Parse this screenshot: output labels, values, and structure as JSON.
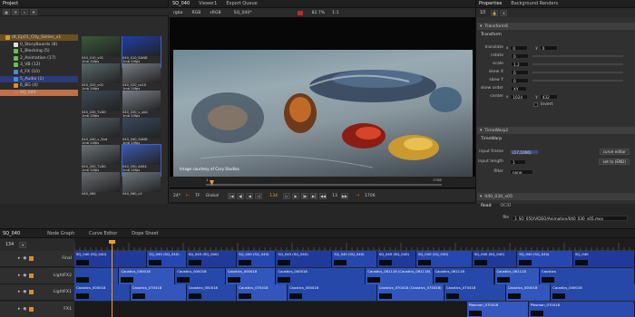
{
  "project_panel": {
    "title": "Project",
    "tree": [
      {
        "label": "dt_Ep01_City_Series_v1",
        "color": "#d79a3a"
      },
      {
        "label": "0_StoryBoards (8)",
        "color": "#e0e0e0"
      },
      {
        "label": "1_Blocking (5)",
        "color": "#6ac04a"
      },
      {
        "label": "2_Animation (17)",
        "color": "#6ac04a"
      },
      {
        "label": "3_VB (12)",
        "color": "#6ac04a"
      },
      {
        "label": "4_FX (10)",
        "color": "#4a8ad8"
      },
      {
        "label": "5_Audio (1)",
        "color": "#4a8ad8"
      },
      {
        "label": "6_BG (4)",
        "color": "#e08a2a"
      },
      {
        "label": "SQ_040",
        "color": "#d0704a"
      }
    ],
    "thumbs": [
      {
        "line1": "040_010_v01",
        "line2": "1mb  24fps",
        "line3": "00:00:00:00 24f"
      },
      {
        "line1": "040_010_SAND",
        "line2": "1mb  24fps",
        "line3": "00:00:00:00 24f"
      },
      {
        "line1": "040_020_v02",
        "line2": "1mb  24fps",
        "line3": "00:00:00:00 24f"
      },
      {
        "line1": "040_020_ca10",
        "line2": "1mb  24fps",
        "line3": "00:00:00:00 24f"
      },
      {
        "line1": "040_030_TvD0",
        "line2": "1mb  24fps",
        "line3": "00:00:00:00 24f"
      },
      {
        "line1": "040_030_v_ab1",
        "line2": "1mb  24fps",
        "line3": "00:00:00:00 24f"
      },
      {
        "line1": "040_040_v_Shd",
        "line2": "1mb  24fps",
        "line3": "00:00:00:00 24f"
      },
      {
        "line1": "040_040_SAND",
        "line2": "1mb  24fps",
        "line3": "00:00:00:00 24f"
      },
      {
        "line1": "040_050_TvD0",
        "line2": "1mb  24fps",
        "line3": "00:00:00:00 24f"
      },
      {
        "line1": "040_050_A004",
        "line2": "1mb  24fps",
        "line3": "00:00:00:00 24f"
      },
      {
        "line1": "040_060",
        "line2": "",
        "line3": ""
      },
      {
        "line1": "040_060_v2",
        "line2": "",
        "line3": ""
      }
    ]
  },
  "viewer_panel": {
    "tabs": [
      "SQ_040",
      "Viewer1",
      "Export Queue"
    ],
    "toolbar": {
      "channels": "rgba",
      "colorspace": "RGB",
      "lut": "sRGB",
      "sequence": "SQ_040*",
      "zoom": "82.7%",
      "ratio": "1:1"
    },
    "credit": "Image courtesy of Cary Studios",
    "scrub_start": "1",
    "scrub_end": "1706",
    "frame_left": "24*",
    "tf": "TF",
    "global_label": "Global",
    "current_frame": "134",
    "step": "13",
    "end_frame": "1706"
  },
  "properties_panel": {
    "tabs": [
      "Properties",
      "Background Renders"
    ],
    "toolbar_number": "10",
    "nodes": [
      {
        "name": "Transform6",
        "section": "Transform"
      },
      {
        "name": "TimeWarp2",
        "section": "TimeWarp"
      },
      {
        "name": "040_030_v05",
        "section": "Read"
      }
    ],
    "transform": {
      "translate_label": "translate",
      "translate_x": "0",
      "translate_y": "0",
      "rotate_label": "rotate",
      "rotate": "0",
      "scale_label": "scale",
      "scale": "1.2",
      "skew_x_label": "skew X",
      "skew_x": "0",
      "skew_y_label": "skew Y",
      "skew_y": "0",
      "skew_order_label": "skew order",
      "skew_order": "XY",
      "center_label": "center",
      "center_x": "1024",
      "center_y": "432",
      "invert": "invert"
    },
    "timewarp": {
      "input_frame_label": "input frame",
      "input_frame": "(17,1006)",
      "curve_editor": "curve editor",
      "input_length_label": "input length",
      "input_length": "1",
      "set_to_end": "set to (END)",
      "filter_label": "filter",
      "filter": "none"
    },
    "read": {
      "tab": "OCIO",
      "file_label": "file",
      "file": "3_SQ_050/VIDEO/Animation/040_030_v05.mov"
    }
  },
  "timeline_panel": {
    "tabs": [
      "SQ_040",
      "Node Graph",
      "Curve Editor",
      "Dope Sheet"
    ],
    "frame": "134",
    "tracks": [
      {
        "name": "Final",
        "clips": [
          {
            "label": "SQ_040 (SQ_040)",
            "w": 13
          },
          {
            "label": "SQ_040 (SQ_040)",
            "w": 7
          },
          {
            "label": "SQ_040 (SQ_040)",
            "w": 9
          },
          {
            "label": "SQ_040 (SQ_040)",
            "w": 7
          },
          {
            "label": "SQ_040 (SQ_040)",
            "w": 10
          },
          {
            "label": "SQ_040 (SQ_040)",
            "w": 8
          },
          {
            "label": "SQ_040 (SQ_040)",
            "w": 7
          },
          {
            "label": "SQ_040 (SQ_040)",
            "w": 10
          },
          {
            "label": "SQ_040 (SQ_040)",
            "w": 8
          },
          {
            "label": "SQ_040 (SQ_040)",
            "w": 10
          },
          {
            "label": "SQ_040",
            "w": 11
          }
        ]
      },
      {
        "name": "LightFX2",
        "clips": [
          {
            "label": "",
            "w": 8
          },
          {
            "label": "Caustics_000018",
            "w": 10
          },
          {
            "label": "Caustics_000018",
            "w": 9
          },
          {
            "label": "Caustics_000018",
            "w": 9
          },
          {
            "label": "Caustics_000018",
            "w": 16
          },
          {
            "label": "Caustics_061118 (Caustics_061118)",
            "w": 12
          },
          {
            "label": "Caustics_061118",
            "w": 11
          },
          {
            "label": "Caustics_061118",
            "w": 8
          },
          {
            "label": "Caustics",
            "w": 17
          }
        ]
      },
      {
        "name": "LightFX1",
        "clips": [
          {
            "label": "Caustics_000018",
            "w": 10
          },
          {
            "label": "Caustics_070418",
            "w": 10
          },
          {
            "label": "Caustics_000018",
            "w": 9
          },
          {
            "label": "Caustics_070418",
            "w": 9
          },
          {
            "label": "Caustics_000018",
            "w": 16
          },
          {
            "label": "Caustics_070418 (Caustics_070418)",
            "w": 12
          },
          {
            "label": "Caustics_070418",
            "w": 11
          },
          {
            "label": "Caustics_000018",
            "w": 8
          },
          {
            "label": "Caustics_000018",
            "w": 17
          }
        ]
      },
      {
        "name": "FX1",
        "clips": [
          {
            "label": "",
            "w": 70
          },
          {
            "label": "Plasmon_070418",
            "w": 11
          },
          {
            "label": "Plasmon_070418",
            "w": 19
          }
        ]
      }
    ]
  },
  "colors": {
    "accent_orange": "#f39c2a",
    "clip_blue": "#2a4aa8",
    "clip_blue_light": "#3758c0",
    "selection": "#4060d0"
  }
}
